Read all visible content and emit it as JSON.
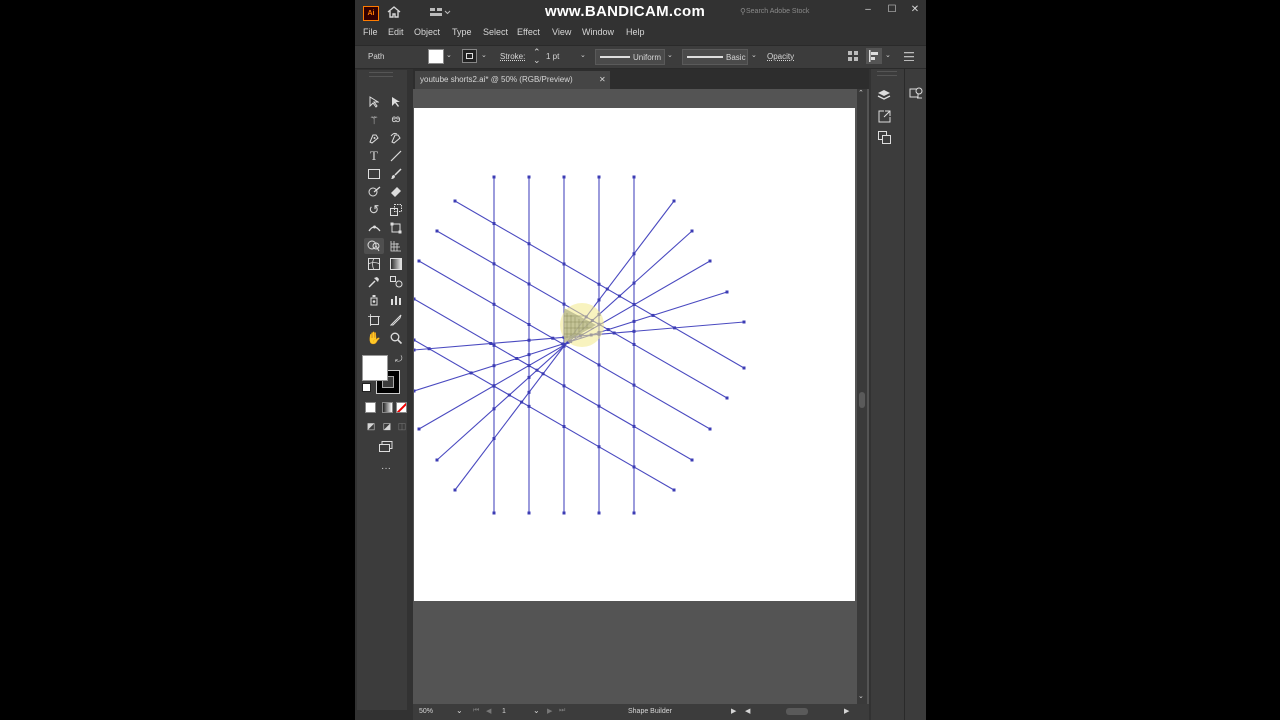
{
  "app": {
    "logo": "Ai",
    "home_icon": "home-icon"
  },
  "watermark": "www.BANDICAM.com",
  "search": {
    "placeholder": "Search Adobe Stock"
  },
  "window_controls": {
    "minimize": "–",
    "maximize": "☐",
    "close": "✕"
  },
  "menu": [
    "File",
    "Edit",
    "Object",
    "Type",
    "Select",
    "Effect",
    "View",
    "Window",
    "Help"
  ],
  "control_bar": {
    "selection_type": "Path",
    "stroke_label": "Stroke:",
    "stroke_weight": "1 pt",
    "profile_uniform": "Uniform",
    "brush_basic": "Basic",
    "opacity_label": "Opacity"
  },
  "document_tab": {
    "title": "youtube shorts2.ai* @ 50% (RGB/Preview)",
    "close": "✕"
  },
  "status_bar": {
    "zoom": "50%",
    "artboard_number": "1",
    "current_tool": "Shape Builder"
  },
  "colors": {
    "path_stroke": "#4a4ac0",
    "anchor": "#3c3cb4",
    "highlight": "#f2e98a",
    "app_bg": "#323232",
    "panel_bg": "#3c3c3c"
  },
  "tools": [
    "selection-tool",
    "direct-selection-tool",
    "magic-wand-tool",
    "lasso-tool",
    "pen-tool",
    "curvature-tool",
    "type-tool",
    "line-segment-tool",
    "rectangle-tool",
    "paintbrush-tool",
    "shaper-tool",
    "eraser-tool",
    "rotate-tool",
    "scale-tool",
    "width-tool",
    "free-transform-tool",
    "shape-builder-tool",
    "perspective-grid-tool",
    "mesh-tool",
    "gradient-tool",
    "eyedropper-tool",
    "blend-tool",
    "symbol-sprayer-tool",
    "column-graph-tool",
    "artboard-tool",
    "slice-tool",
    "hand-tool",
    "zoom-tool"
  ]
}
